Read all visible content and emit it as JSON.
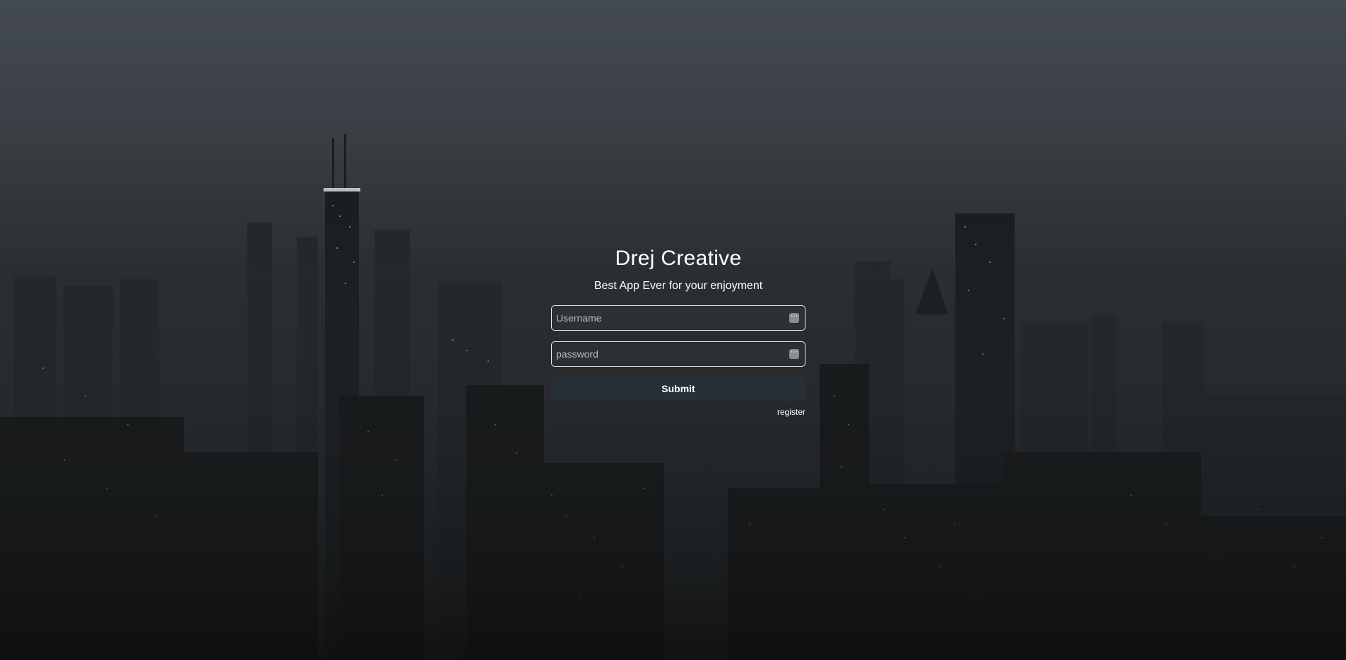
{
  "header": {
    "title": "Drej Creative",
    "subtitle": "Best App Ever for your enjoyment"
  },
  "form": {
    "username": {
      "value": "",
      "placeholder": "Username",
      "icon": "password-manager-icon"
    },
    "password": {
      "value": "",
      "placeholder": "password",
      "icon": "password-manager-icon"
    },
    "submit_label": "Submit",
    "register_label": "register"
  },
  "background": {
    "description_icon": "city-skyline-background",
    "colors": {
      "sky_top": "#444b50",
      "ground": "#151718",
      "button": "#263036"
    }
  }
}
